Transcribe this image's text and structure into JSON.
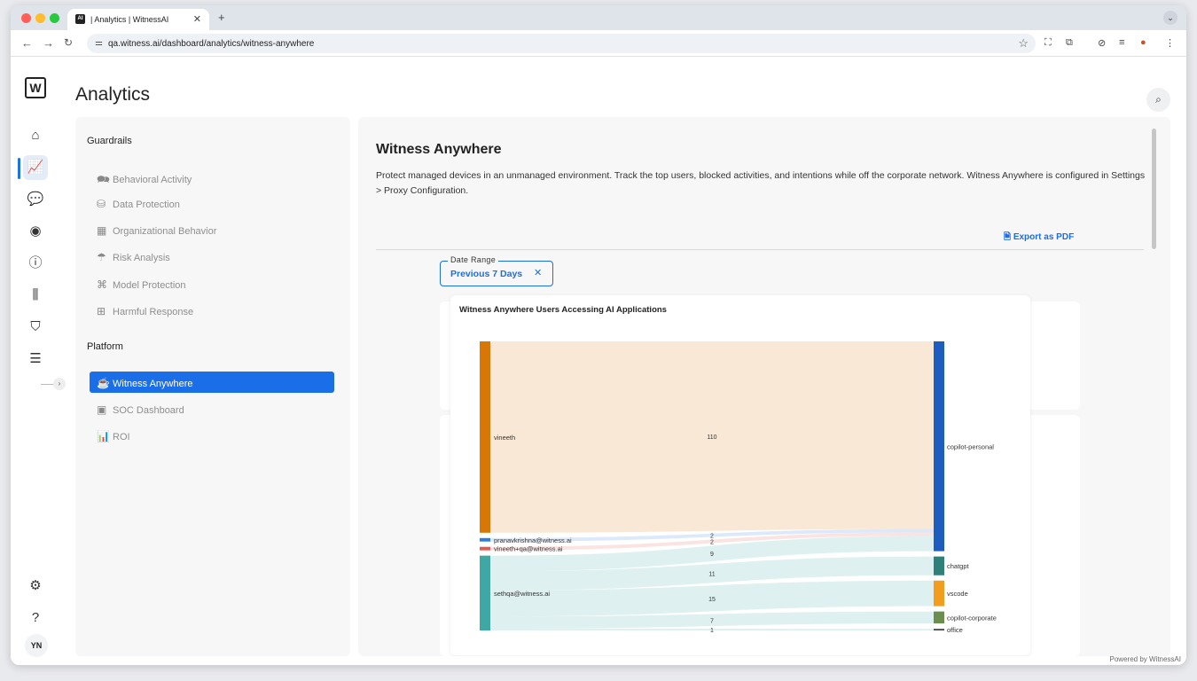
{
  "browser": {
    "tab_title": "| Analytics | WitnessAI",
    "tab_favicon": "AI",
    "url": "qa.witness.ai/dashboard/analytics/witness-anywhere"
  },
  "app": {
    "logo_letter": "W",
    "page_title": "Analytics",
    "user_initials": "YN",
    "powered_by": "Powered by WitnessAI"
  },
  "sidebar": {
    "guardrails_header": "Guardrails",
    "guardrails": [
      {
        "label": "Behavioral Activity",
        "icon": "chat-bubbles-icon"
      },
      {
        "label": "Data Protection",
        "icon": "database-icon"
      },
      {
        "label": "Organizational Behavior",
        "icon": "building-icon"
      },
      {
        "label": "Risk Analysis",
        "icon": "umbrella-icon"
      },
      {
        "label": "Model Protection",
        "icon": "network-icon"
      },
      {
        "label": "Harmful Response",
        "icon": "first-aid-icon"
      }
    ],
    "platform_header": "Platform",
    "platform": [
      {
        "label": "Witness Anywhere",
        "icon": "coffee-cup-icon",
        "active": true
      },
      {
        "label": "SOC Dashboard",
        "icon": "dashboard-grid-icon"
      },
      {
        "label": "ROI",
        "icon": "chart-growth-icon"
      }
    ]
  },
  "main": {
    "title": "Witness Anywhere",
    "description": "Protect managed devices in an unmanaged environment. Track the top users, blocked activities, and intentions while off the corporate network. Witness Anywhere is configured in Settings > Proxy Configuration.",
    "export_label": "Export as PDF",
    "date_range": {
      "label": "Date Range",
      "value": "Previous 7 Days"
    }
  },
  "chart_data": {
    "type": "sankey",
    "title": "Witness Anywhere Users Accessing AI Applications",
    "sources": [
      {
        "name": "vineeth",
        "color": "#d97706"
      },
      {
        "name": "pranavkrishna@witness.ai",
        "color": "#2f7be0"
      },
      {
        "name": "vineeth+qa@witness.ai",
        "color": "#e05a4f"
      },
      {
        "name": "sethqa@witness.ai",
        "color": "#3fa7a4"
      }
    ],
    "targets": [
      {
        "name": "copilot-personal",
        "color": "#1c5dbf"
      },
      {
        "name": "chatgpt",
        "color": "#2f7f7b"
      },
      {
        "name": "vscode",
        "color": "#f29d1e"
      },
      {
        "name": "copilot-corporate",
        "color": "#6b8e4e"
      },
      {
        "name": "office",
        "color": "#555555"
      }
    ],
    "links": [
      {
        "source": "vineeth",
        "target": "copilot-personal",
        "value": 110
      },
      {
        "source": "pranavkrishna@witness.ai",
        "target": "copilot-personal",
        "value": 2
      },
      {
        "source": "vineeth+qa@witness.ai",
        "target": "copilot-personal",
        "value": 2
      },
      {
        "source": "sethqa@witness.ai",
        "target": "copilot-personal",
        "value": 9
      },
      {
        "source": "sethqa@witness.ai",
        "target": "chatgpt",
        "value": 11
      },
      {
        "source": "sethqa@witness.ai",
        "target": "vscode",
        "value": 15
      },
      {
        "source": "sethqa@witness.ai",
        "target": "copilot-corporate",
        "value": 7
      },
      {
        "source": "sethqa@witness.ai",
        "target": "office",
        "value": 1
      }
    ],
    "value_labels": [
      "110",
      "2",
      "9",
      "11",
      "15",
      "7",
      "1"
    ]
  }
}
